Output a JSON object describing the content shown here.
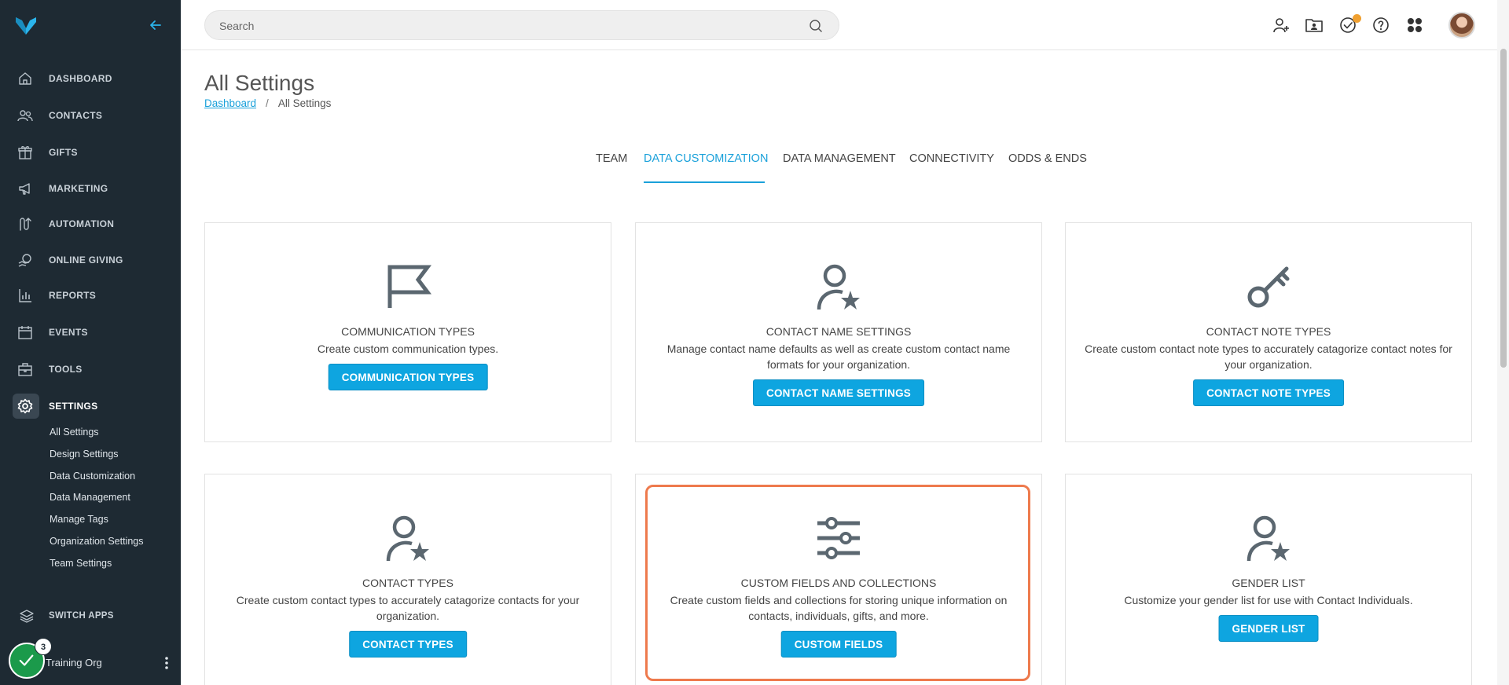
{
  "sidebar": {
    "nav": [
      {
        "label": "DASHBOARD",
        "icon": "home-icon"
      },
      {
        "label": "CONTACTS",
        "icon": "contacts-icon"
      },
      {
        "label": "GIFTS",
        "icon": "gift-icon"
      },
      {
        "label": "MARKETING",
        "icon": "megaphone-icon"
      },
      {
        "label": "AUTOMATION",
        "icon": "automation-icon"
      },
      {
        "label": "ONLINE GIVING",
        "icon": "online-giving-icon"
      },
      {
        "label": "REPORTS",
        "icon": "reports-icon"
      },
      {
        "label": "EVENTS",
        "icon": "calendar-icon"
      },
      {
        "label": "TOOLS",
        "icon": "toolbox-icon"
      },
      {
        "label": "SETTINGS",
        "icon": "gear-icon"
      }
    ],
    "sub_items": [
      "All Settings",
      "Design Settings",
      "Data Customization",
      "Data Management",
      "Manage Tags",
      "Organization Settings",
      "Team Settings"
    ],
    "switch_apps": "SWITCH APPS",
    "org": {
      "name": "Training Org",
      "badge": "3"
    }
  },
  "search": {
    "placeholder": "Search"
  },
  "page": {
    "title": "All Settings",
    "breadcrumb": {
      "root": "Dashboard",
      "separator": "/",
      "current": "All Settings"
    }
  },
  "tabs": [
    "TEAM",
    "DATA CUSTOMIZATION",
    "DATA MANAGEMENT",
    "CONNECTIVITY",
    "ODDS & ENDS"
  ],
  "cards": [
    {
      "title": "COMMUNICATION TYPES",
      "desc": "Create custom communication types.",
      "button": "COMMUNICATION TYPES",
      "icon": "flag-icon"
    },
    {
      "title": "CONTACT NAME SETTINGS",
      "desc": "Manage contact name defaults as well as create custom contact name formats for your organization.",
      "button": "CONTACT NAME SETTINGS",
      "icon": "user-star-icon"
    },
    {
      "title": "CONTACT NOTE TYPES",
      "desc": "Create custom contact note types to accurately catagorize contact notes for your organization.",
      "button": "CONTACT NOTE TYPES",
      "icon": "key-icon"
    },
    {
      "title": "CONTACT TYPES",
      "desc": "Create custom contact types to accurately catagorize contacts for your organization.",
      "button": "CONTACT TYPES",
      "icon": "user-star-icon"
    },
    {
      "title": "CUSTOM FIELDS AND COLLECTIONS",
      "desc": "Create custom fields and collections for storing unique information on contacts, individuals, gifts, and more.",
      "button": "CUSTOM FIELDS",
      "icon": "sliders-icon"
    },
    {
      "title": "GENDER LIST",
      "desc": "Customize your gender list for use with Contact Individuals.",
      "button": "GENDER LIST",
      "icon": "user-star-icon"
    }
  ],
  "colors": {
    "accent": "#0ea5e0",
    "sidebar": "#1e2a33",
    "highlight": "#ee7a4d",
    "active_tab": "#1aa1da"
  }
}
